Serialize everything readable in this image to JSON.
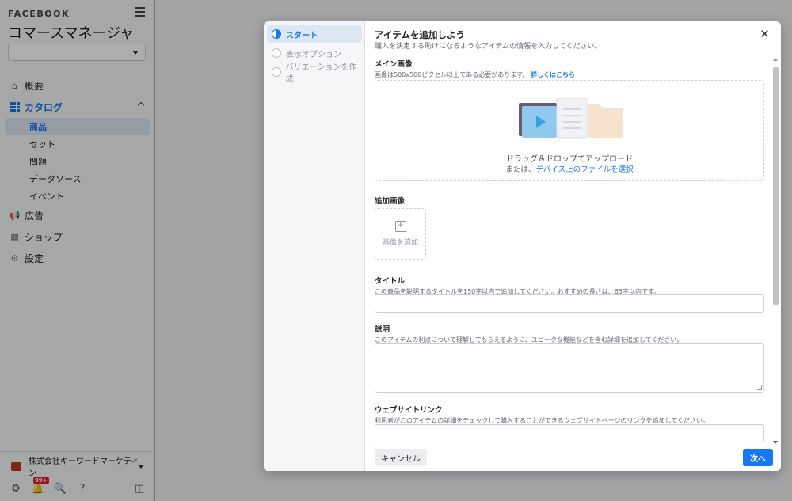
{
  "sidebar": {
    "brand": "FACEBOOK",
    "app_title": "コマースマネージャ",
    "account_select_value": "",
    "nav": {
      "overview": "概要",
      "catalog": "カタログ",
      "catalog_sub": [
        "商品",
        "セット",
        "問題",
        "データソース",
        "イベント"
      ],
      "ads": "広告",
      "shop": "ショップ",
      "settings": "設定"
    },
    "business_name": "株式会社キーワードマーケティン",
    "notification_badge": "99+"
  },
  "modal": {
    "steps": [
      "スタート",
      "表示オプション",
      "バリエーションを作成"
    ],
    "title": "アイテムを追加しよう",
    "subtitle": "購入を決定する助けになるようなアイテムの情報を入力してください。",
    "main_image": {
      "label": "メイン画像",
      "help": "画像は500x500ピクセル以上である必要があります。",
      "help_link": "詳しくはこちら",
      "drop_text": "ドラッグ＆ドロップでアップロード",
      "or_text": "または、",
      "select_link": "デバイス上のファイルを選択"
    },
    "additional_images": {
      "label": "追加画像",
      "add_label": "画像を追加"
    },
    "title_field": {
      "label": "タイトル",
      "help": "この商品を説明するタイトルを150字以内で追加してください。おすすめの長さは、65字以内です。",
      "value": ""
    },
    "description_field": {
      "label": "説明",
      "help": "このアイテムの利点について理解してもらえるように、ユニークな機能などを含む詳細を追加してください。",
      "value": ""
    },
    "website_field": {
      "label": "ウェブサイトリンク",
      "help": "利用者がこのアイテムの詳細をチェックして購入することができるウェブサイトページのリンクを追加してください。",
      "value": ""
    },
    "cancel_label": "キャンセル",
    "next_label": "次へ"
  },
  "colors": {
    "accent": "#1877f2",
    "badge": "#e41e3f"
  }
}
